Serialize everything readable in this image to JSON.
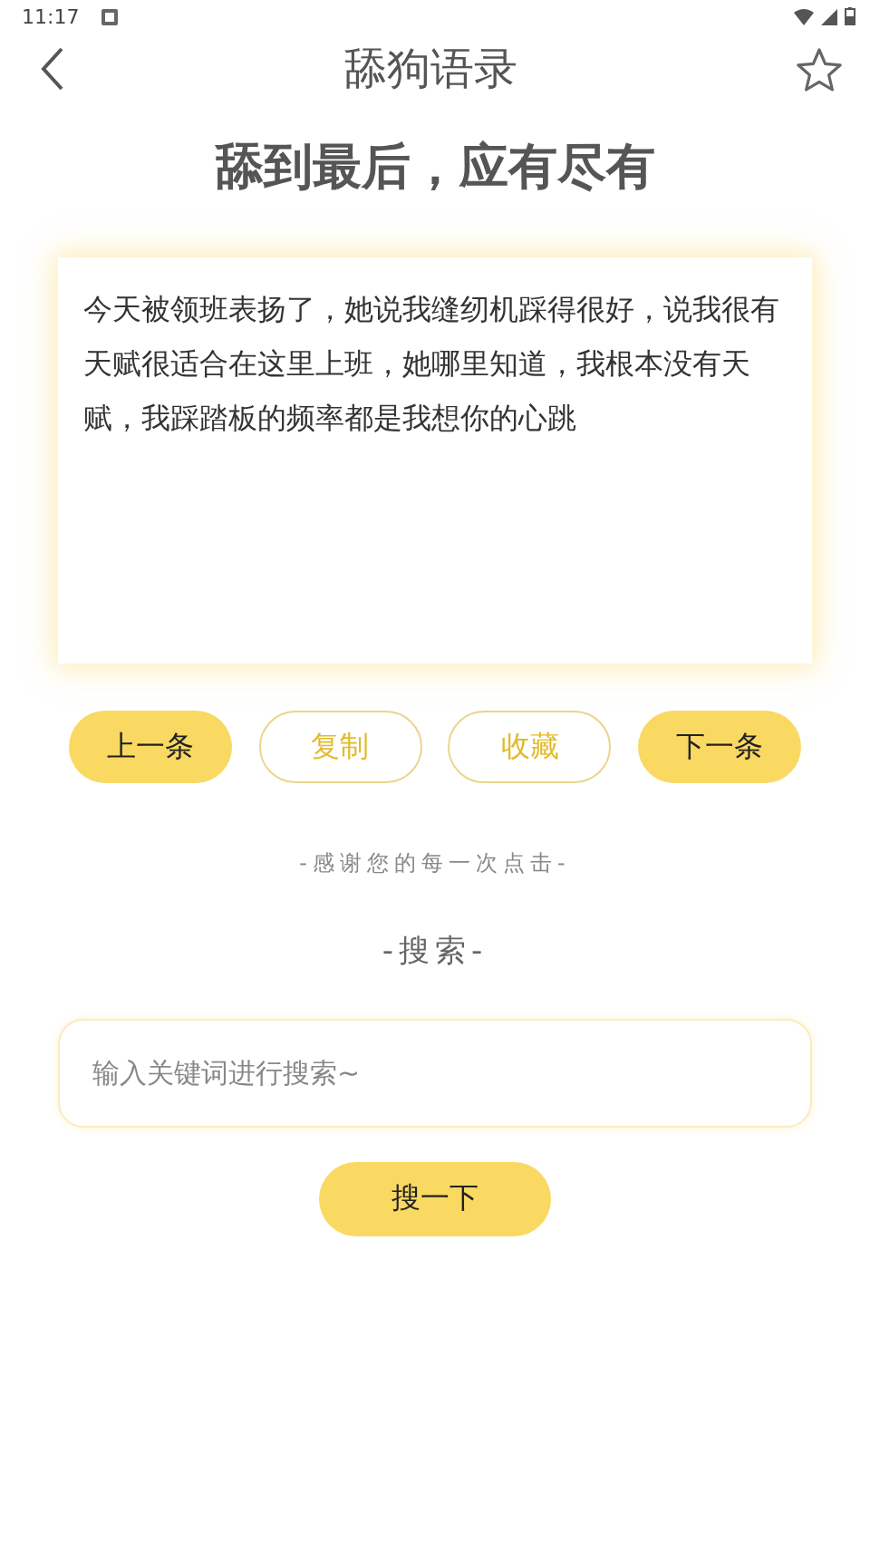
{
  "status_bar": {
    "time": "11:17"
  },
  "nav": {
    "title": "舔狗语录"
  },
  "headline": "舔到最后，应有尽有",
  "quote": "今天被领班表扬了，她说我缝纫机踩得很好，说我很有天赋很适合在这里上班，她哪里知道，我根本没有天赋，我踩踏板的频率都是我想你的心跳",
  "actions": [
    {
      "label": "上一条",
      "kind": "filled"
    },
    {
      "label": "复制",
      "kind": "outline"
    },
    {
      "label": "收藏",
      "kind": "outline"
    },
    {
      "label": "下一条",
      "kind": "filled"
    }
  ],
  "thanks": "-感谢您的每一次点击-",
  "search": {
    "title": "-搜索-",
    "placeholder": "输入关键词进行搜索~",
    "button": "搜一下"
  }
}
